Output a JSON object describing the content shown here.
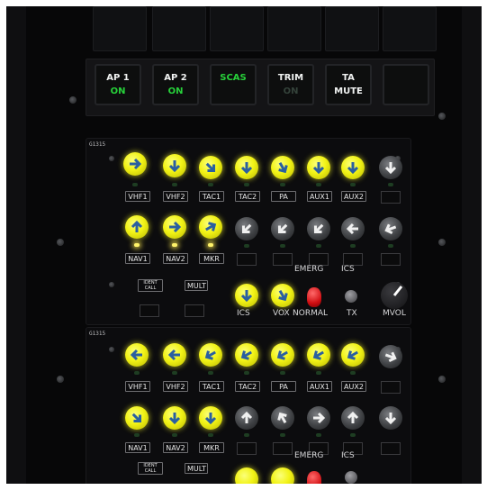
{
  "annunciators": {
    "ap1": {
      "line1": "AP 1",
      "line2": "ON"
    },
    "ap2": {
      "line1": "AP 2",
      "line2": "ON"
    },
    "scas": {
      "line1": "SCAS"
    },
    "trim": {
      "line1": "TRIM",
      "line2": "ON"
    },
    "ta_mute": {
      "line1": "TA",
      "line2": "MUTE"
    }
  },
  "colors": {
    "annun_white": "#f1f3f2",
    "annun_green": "#27d13a",
    "annun_dim": "#34423a",
    "knob_lit": "#f2f316"
  },
  "panel_upper": {
    "part_no": "G1315",
    "row1_labels": [
      "VHF1",
      "VHF2",
      "TAC1",
      "TAC2",
      "PA",
      "AUX1",
      "AUX2"
    ],
    "row2_labels": [
      "NAV1",
      "NAV2",
      "MKR"
    ],
    "switch_labels": {
      "ident_call": "IDENT CALL",
      "mult": "MULT"
    },
    "bottom_labels": {
      "ics": "ICS",
      "vox": "VOX",
      "emerg": "EMERG",
      "normal": "NORMAL",
      "ics_top": "ICS",
      "tx": "TX",
      "mvol": "MVOL"
    }
  },
  "panel_lower": {
    "part_no": "G1315",
    "row1_labels": [
      "VHF1",
      "VHF2",
      "TAC1",
      "TAC2",
      "PA",
      "AUX1",
      "AUX2"
    ],
    "row2_labels": [
      "NAV1",
      "NAV2",
      "MKR"
    ],
    "switch_labels": {
      "ident_call": "IDENT CALL",
      "mult": "MULT"
    },
    "bottom_labels": {
      "emerg": "EMERG",
      "ics": "ICS"
    }
  }
}
